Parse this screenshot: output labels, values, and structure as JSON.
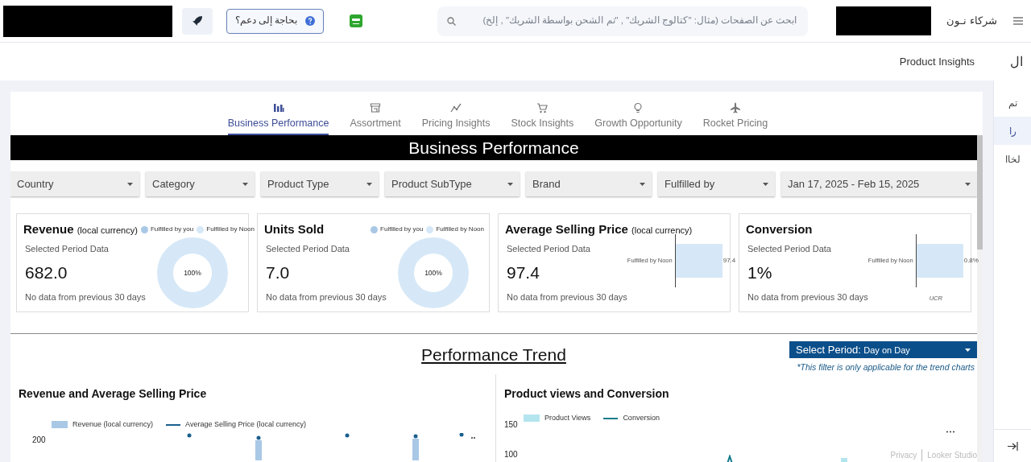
{
  "topbar": {
    "help_button": "بحاجة إلى دعم؟",
    "search": {
      "placeholder": "ابحث عن الصفحات (مثال: \"كتالوج الشريك\" , \"تم الشحن بواسطة الشريك\" , إلخ)"
    },
    "brand": "شركاء نـون"
  },
  "subheader": {
    "title": "Product Insights",
    "side_label": "ال"
  },
  "sidebar": {
    "items": [
      {
        "label": "تم",
        "selected": false
      },
      {
        "label": "را",
        "selected": true
      },
      {
        "label": "لخاا",
        "selected": false
      }
    ]
  },
  "report": {
    "tabs": [
      {
        "label": "Business Performance",
        "selected": true
      },
      {
        "label": "Assortment",
        "selected": false
      },
      {
        "label": "Pricing Insights",
        "selected": false
      },
      {
        "label": "Stock Insights",
        "selected": false
      },
      {
        "label": "Growth Opportunity",
        "selected": false
      },
      {
        "label": "Rocket Pricing",
        "selected": false
      }
    ],
    "banner": "Business Performance",
    "filters": [
      "Country",
      "Category",
      "Product Type",
      "Product SubType",
      "Brand",
      "Fulfilled by",
      "Jan 17, 2025 - Feb 15, 2025"
    ],
    "kpis": [
      {
        "kind": "donut",
        "title": "Revenue",
        "subtitle": "(local currency)",
        "period_label": "Selected Period Data",
        "value": "682.0",
        "note": "No data from previous 30 days",
        "legend": [
          {
            "label": "Fulfilled by you",
            "color": "#a9c8e6"
          },
          {
            "label": "Fulfilled by Noon",
            "color": "#d6e8f7"
          }
        ],
        "center_label": "100%"
      },
      {
        "kind": "donut",
        "title": "Units Sold",
        "period_label": "Selected Period Data",
        "value": "7.0",
        "note": "No data from previous 30 days",
        "legend": [
          {
            "label": "Fulfilled by you",
            "color": "#a9c8e6"
          },
          {
            "label": "Fulfilled by Noon",
            "color": "#d6e8f7"
          }
        ],
        "center_label": "100%"
      },
      {
        "kind": "bar",
        "title": "Average Selling Price",
        "subtitle": "(local currency)",
        "period_label": "Selected Period Data",
        "value": "97.4",
        "note": "No data from previous 30 days",
        "bar_label": "Fulfilled by Noon",
        "bar_value": "97.4"
      },
      {
        "kind": "bar",
        "title": "Conversion",
        "period_label": "Selected Period Data",
        "value": "1%",
        "note": "No data from previous 30 days",
        "bar_label": "Fulfilled by Noon",
        "bar_value": "0.8%",
        "axis_label": "UCR"
      }
    ],
    "trend": {
      "title": "Performance Trend",
      "period": {
        "label": "Select Period:",
        "value": "Day on Day"
      },
      "note": "*This filter is only applicable for the trend charts",
      "charts": [
        {
          "title": "Revenue and Average Selling Price",
          "legend": [
            {
              "kind": "bar",
              "label": "Revenue (local currency)",
              "color": "#a9c8e6"
            },
            {
              "kind": "line",
              "label": "Average Selling Price (local currency)",
              "color": "#1a5f8e"
            }
          ],
          "y_tick_labels": [
            "200"
          ]
        },
        {
          "title": "Product views and Conversion",
          "legend": [
            {
              "kind": "bar",
              "label": "Product Views",
              "color": "#b3e5ee"
            },
            {
              "kind": "line",
              "label": "Conversion",
              "color": "#137c8b"
            }
          ],
          "y_tick_labels": [
            "150",
            "100"
          ]
        }
      ],
      "footer": [
        "Privacy",
        "Looker Studio"
      ]
    }
  }
}
